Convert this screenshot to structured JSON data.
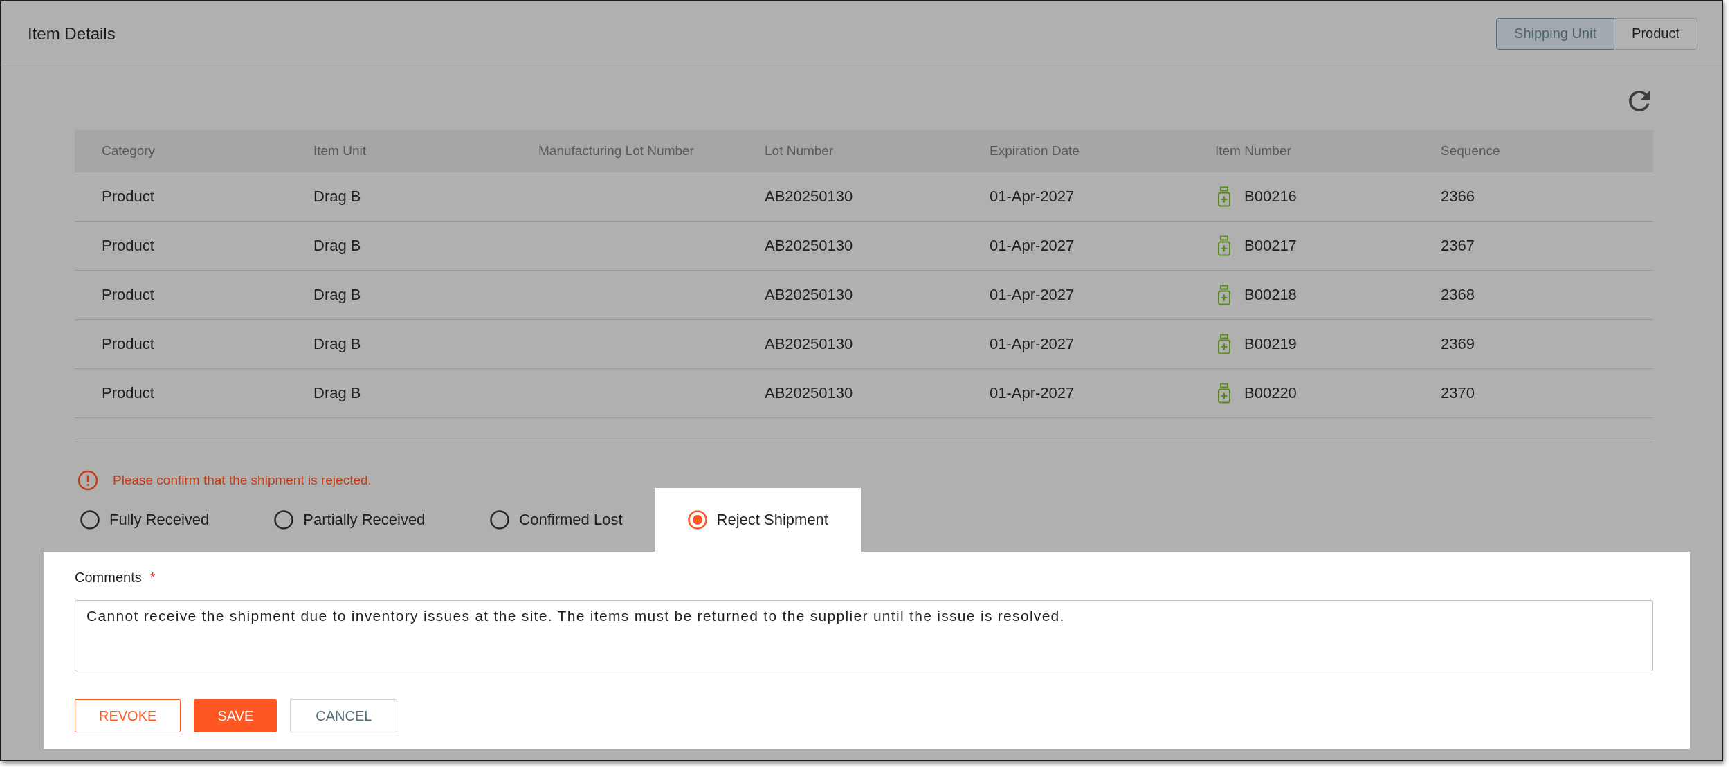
{
  "panel": {
    "title": "Item Details"
  },
  "view_toggle": [
    {
      "label": "Shipping Unit",
      "selected": true
    },
    {
      "label": "Product",
      "selected": false
    }
  ],
  "table": {
    "columns": [
      "Category",
      "Item Unit",
      "Manufacturing Lot Number",
      "Lot Number",
      "Expiration Date",
      "Item Number",
      "Sequence"
    ],
    "rows": [
      {
        "category": "Product",
        "item_unit": "Drag B",
        "lot_number": "AB20250130",
        "expiration_date": "01-Apr-2027",
        "item_number": "B00216",
        "sequence": "2366"
      },
      {
        "category": "Product",
        "item_unit": "Drag B",
        "lot_number": "AB20250130",
        "expiration_date": "01-Apr-2027",
        "item_number": "B00217",
        "sequence": "2367"
      },
      {
        "category": "Product",
        "item_unit": "Drag B",
        "lot_number": "AB20250130",
        "expiration_date": "01-Apr-2027",
        "item_number": "B00218",
        "sequence": "2368"
      },
      {
        "category": "Product",
        "item_unit": "Drag B",
        "lot_number": "AB20250130",
        "expiration_date": "01-Apr-2027",
        "item_number": "B00219",
        "sequence": "2369"
      },
      {
        "category": "Product",
        "item_unit": "Drag B",
        "lot_number": "AB20250130",
        "expiration_date": "01-Apr-2027",
        "item_number": "B00220",
        "sequence": "2370"
      }
    ]
  },
  "warning": {
    "text": "Please confirm that the shipment is rejected."
  },
  "receipt_options": [
    {
      "label": "Fully Received",
      "selected": false
    },
    {
      "label": "Partially Received",
      "selected": false
    },
    {
      "label": "Confirmed Lost",
      "selected": false
    },
    {
      "label": "Reject Shipment",
      "selected": true
    }
  ],
  "comments": {
    "label": "Comments",
    "required_mark": "*",
    "value": "Cannot receive the shipment due to inventory issues at the site. The items must be returned to the supplier until the issue is resolved."
  },
  "buttons": [
    {
      "label": "REVOKE",
      "kind": "outline"
    },
    {
      "label": "SAVE",
      "kind": "primary"
    },
    {
      "label": "CANCEL",
      "kind": "secondary"
    }
  ]
}
